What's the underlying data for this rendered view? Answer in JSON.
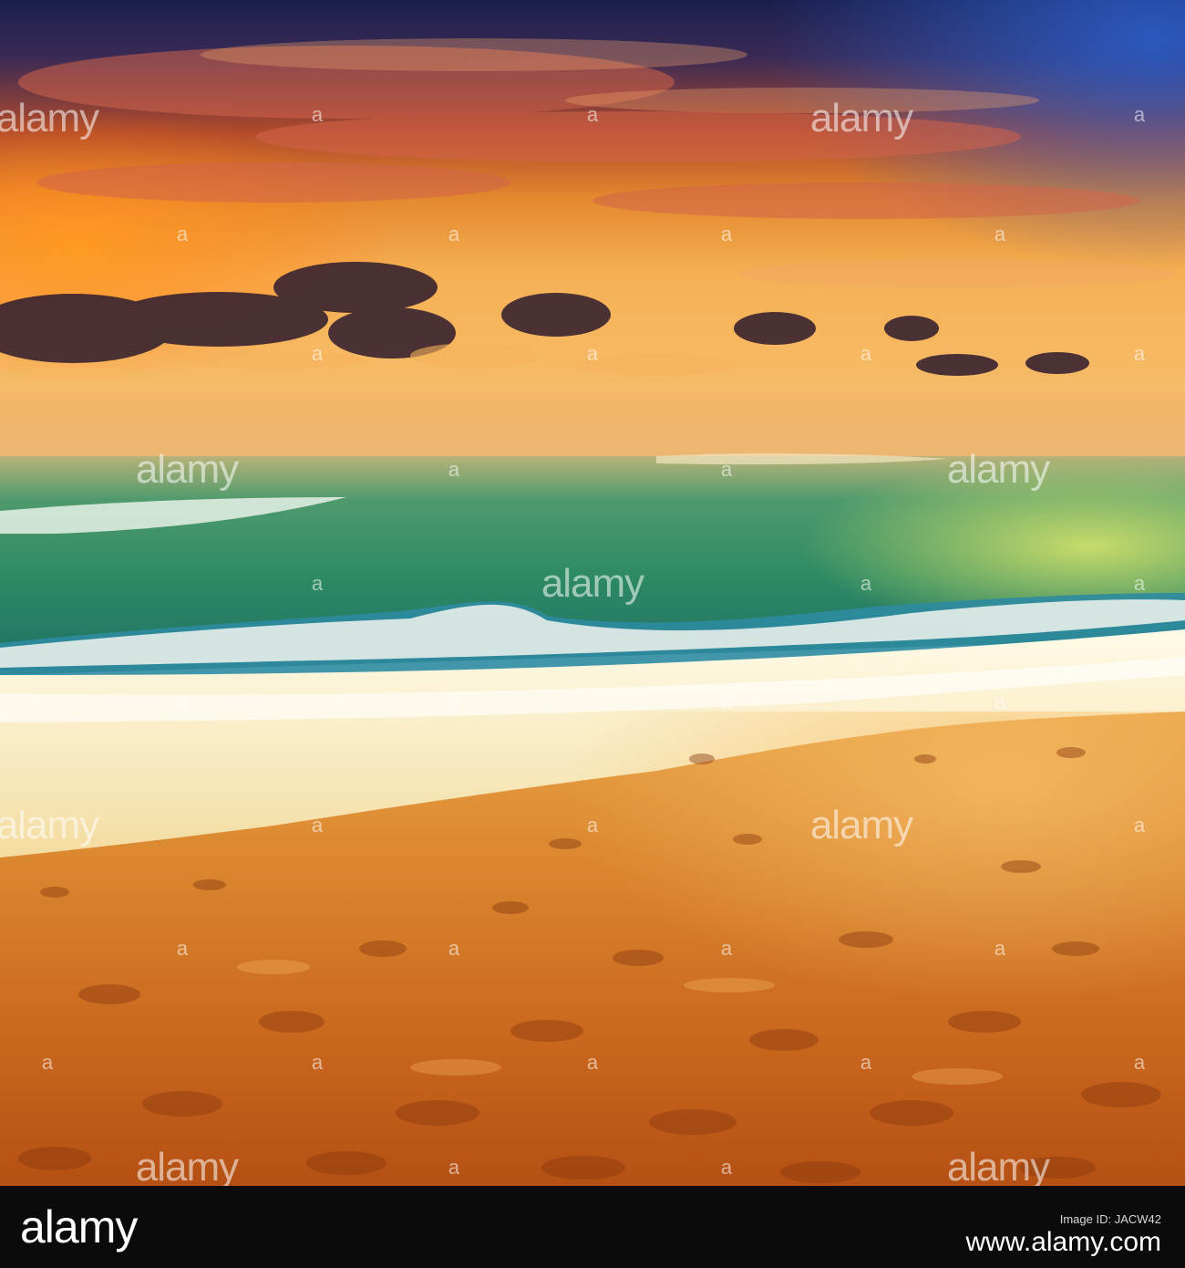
{
  "watermark": {
    "text": "alamy",
    "small": "a"
  },
  "banner": {
    "logo_text": "alamy",
    "caption": "Image ID: JACW42",
    "url": "www.alamy.com"
  }
}
